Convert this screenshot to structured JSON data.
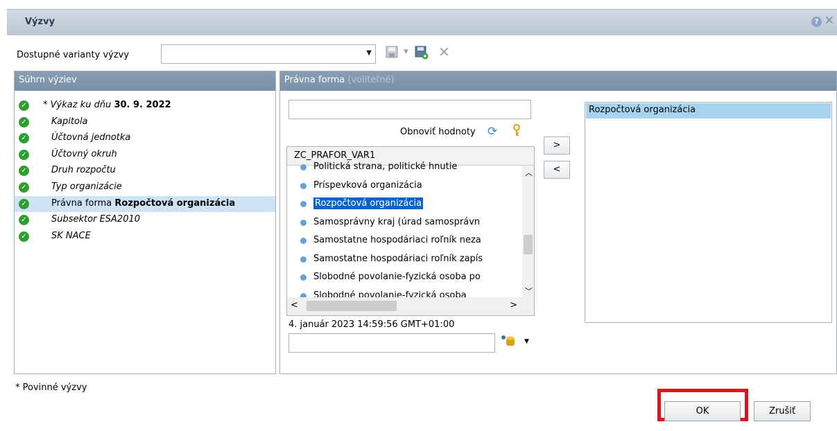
{
  "dialog": {
    "title": "Výzvy",
    "help_icon": "?",
    "close_icon": "✕"
  },
  "variants": {
    "label": "Dostupné varianty výzvy",
    "value": ""
  },
  "summary": {
    "header": "Súhrn výziev",
    "items": [
      {
        "prefix": "* Výkaz ku dňu ",
        "bold": "30. 9. 2022"
      },
      {
        "prefix": "Kapitola",
        "bold": ""
      },
      {
        "prefix": "Účtovná jednotka",
        "bold": ""
      },
      {
        "prefix": "Účtovný okruh",
        "bold": ""
      },
      {
        "prefix": "Druh rozpočtu",
        "bold": ""
      },
      {
        "prefix": "Typ organizácie",
        "bold": ""
      },
      {
        "prefix": "Právna forma ",
        "bold": "Rozpočtová organizácia"
      },
      {
        "prefix": "Subsektor ESA2010",
        "bold": ""
      },
      {
        "prefix": "SK NACE",
        "bold": ""
      }
    ]
  },
  "detail": {
    "header": "Právna forma",
    "header_optional": "(voliteľné)",
    "search_value": "",
    "refresh_label": "Obnoviť hodnoty",
    "list_header": "ZC_PRAFOR_VAR1",
    "list_items": [
      "Politická strana, politické hnutie",
      "Príspevková organizácia",
      "Rozpočtová organizácia",
      "Samosprávny kraj (úrad samosprávn",
      "Samostatne hospodáriaci roľník neza",
      "Samostatne hospodáriaci roľník zapís",
      "Slobodné povolanie-fyzická osoba po",
      "Slobodné povolanie-fyzická osoba"
    ],
    "selected_index": 2,
    "timestamp": "4. január 2023 14:59:56 GMT+01:00",
    "add_button": ">",
    "remove_button": "<",
    "selected_values": [
      "Rozpočtová organizácia"
    ]
  },
  "footer": {
    "mandatory_note": "* Povinné výzvy",
    "ok": "OK",
    "cancel": "Zrušiť"
  },
  "colors": {
    "panel_header": "#7f94ab",
    "selection": "#0a64c8",
    "highlight_border": "#e0121c",
    "check_green": "#2f9e31"
  }
}
